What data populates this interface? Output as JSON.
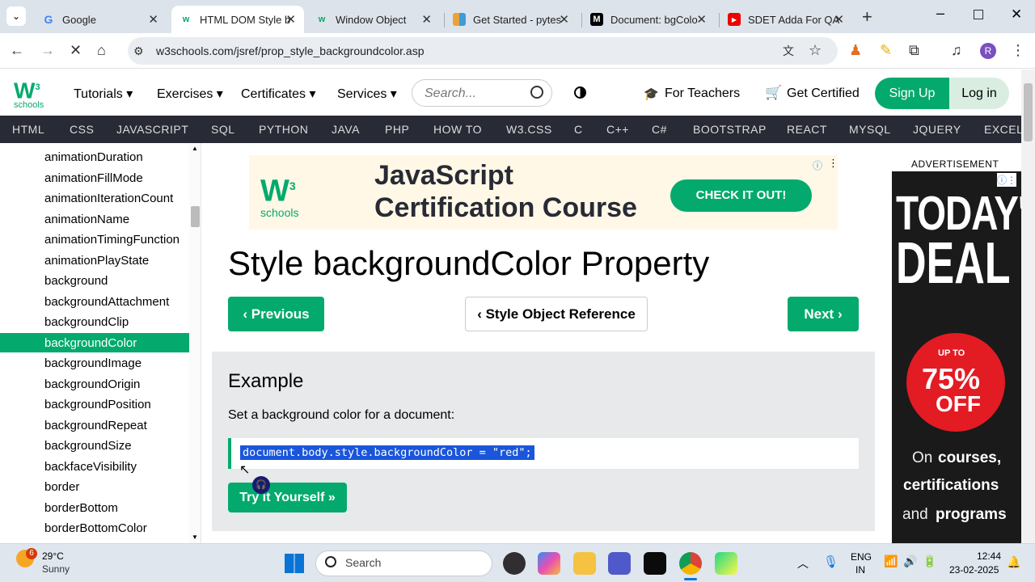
{
  "browser": {
    "tabs": [
      {
        "label": "Google",
        "icon": "google-icon"
      },
      {
        "label": "HTML DOM Style b",
        "icon": "w3schools-icon"
      },
      {
        "label": "Window Object",
        "icon": "w3schools-icon"
      },
      {
        "label": "Get Started - pytes",
        "icon": "pytest-icon"
      },
      {
        "label": "Document: bgColo",
        "icon": "mdn-icon"
      },
      {
        "label": "SDET Adda For QA",
        "icon": "youtube-icon"
      }
    ],
    "url": "w3schools.com/jsref/prop_style_backgroundcolor.asp",
    "profile_initial": "R"
  },
  "header": {
    "logo_sup": "3",
    "logo_sub": "schools",
    "menus": [
      "Tutorials",
      "Exercises",
      "Certificates",
      "Services"
    ],
    "search_placeholder": "Search...",
    "for_teachers": "For Teachers",
    "get_certified": "Get Certified",
    "sign_up": "Sign Up",
    "log_in": "Log in"
  },
  "topnav": [
    "HTML",
    "CSS",
    "JAVASCRIPT",
    "SQL",
    "PYTHON",
    "JAVA",
    "PHP",
    "HOW TO",
    "W3.CSS",
    "C",
    "C++",
    "C#",
    "BOOTSTRAP",
    "REACT",
    "MYSQL",
    "JQUERY",
    "EXCEL"
  ],
  "sidebar": {
    "items": [
      "animationDuration",
      "animationFillMode",
      "animationIterationCount",
      "animationName",
      "animationTimingFunction",
      "animationPlayState",
      "background",
      "backgroundAttachment",
      "backgroundClip",
      "backgroundColor",
      "backgroundImage",
      "backgroundOrigin",
      "backgroundPosition",
      "backgroundRepeat",
      "backgroundSize",
      "backfaceVisibility",
      "border",
      "borderBottom",
      "borderBottomColor"
    ],
    "active": "backgroundColor"
  },
  "ad": {
    "logo_sup": "3",
    "logo_sub": "schools",
    "headline_1": "JavaScript",
    "headline_2": "Certification Course",
    "cta": "CHECK IT OUT!"
  },
  "main": {
    "title": "Style backgroundColor Property",
    "prev": "Previous",
    "reference": "Style Object Reference",
    "next": "Next",
    "example_heading": "Example",
    "example_desc": "Set a background color for a document:",
    "code": "document.body.style.backgroundColor = \"red\";",
    "try_button": "Try it Yourself »"
  },
  "right_ad": {
    "label": "ADVERTISEMENT",
    "line1": "TODAY'S",
    "line2": "DEAL",
    "up_to": "UP TO",
    "percent": "75%",
    "off": "OFF",
    "on": "On",
    "courses": "courses,",
    "certifications": "certifications",
    "and": "and",
    "programs": "programs"
  },
  "taskbar": {
    "weather_badge": "6",
    "temp": "29°C",
    "condition": "Sunny",
    "search": "Search",
    "lang1": "ENG",
    "lang2": "IN",
    "time": "12:44",
    "date": "23-02-2025"
  },
  "colors": {
    "w3green": "#04aa6d",
    "navbg": "#282a35",
    "tabstrip": "#dde3ea"
  }
}
